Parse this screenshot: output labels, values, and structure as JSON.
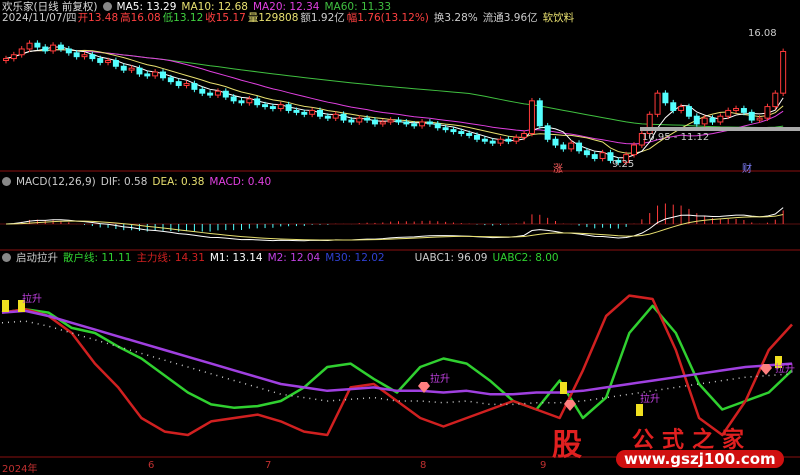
{
  "header": {
    "title": "欢乐家(日线 前复权)",
    "ma5": "MA5: 13.29",
    "ma10": "MA10: 12.68",
    "ma20": "MA20: 12.34",
    "ma60": "MA60: 11.33",
    "date": "2024/11/07/四",
    "open": "开13.48",
    "high": "高16.08",
    "low": "低13.12",
    "close": "收15.17",
    "volume": "量129808",
    "amount": "额1.92亿",
    "change": "幅1.76(13.12%)",
    "turnover": "换3.28%",
    "float": "流通3.96亿",
    "sector": "软饮料"
  },
  "macd_header": {
    "label": "MACD(12,26,9)",
    "dif": "DIF: 0.58",
    "dea": "DEA: 0.38",
    "macd": "MACD: 0.40"
  },
  "ind_header": {
    "label": "启动拉升",
    "retail": "散户线: 11.11",
    "main": "主力线: 14.31",
    "m1": "M1: 13.14",
    "m2": "M2: 12.04",
    "m30": "M30: 12.02",
    "uabc1": "UABC1: 96.09",
    "uabc2": "UABC2: 8.00"
  },
  "annotations": {
    "high": "16.08",
    "low": "9.25",
    "range": "10.95 - 11.12",
    "zhang": "涨",
    "cai": "财",
    "lasheng": "拉升"
  },
  "x_axis": [
    "2024年",
    "6",
    "7",
    "8",
    "9"
  ],
  "watermark": {
    "logo": "股",
    "title": "公式之家",
    "url": "www.gszj100.com"
  },
  "colors": {
    "up": "#ff3b3b",
    "down": "#54ffff",
    "ma5": "#ffffff",
    "ma10": "#e8e070",
    "ma20": "#e040e0",
    "ma60": "#40c040",
    "retail": "#30d030",
    "main": "#d02020",
    "m2": "#a040e0",
    "m30": "#3040d0"
  },
  "chart_data": [
    {
      "type": "candlestick",
      "name": "price",
      "close": [
        14.8,
        15.0,
        15.3,
        15.6,
        15.4,
        15.2,
        15.5,
        15.3,
        15.1,
        14.9,
        15.0,
        14.8,
        14.6,
        14.7,
        14.4,
        14.2,
        14.3,
        14.0,
        13.9,
        14.1,
        13.8,
        13.6,
        13.4,
        13.5,
        13.2,
        13.0,
        12.9,
        13.1,
        12.8,
        12.6,
        12.5,
        12.7,
        12.4,
        12.3,
        12.2,
        12.4,
        12.1,
        12.0,
        11.9,
        12.1,
        11.8,
        11.7,
        11.9,
        11.6,
        11.5,
        11.7,
        11.6,
        11.4,
        11.5,
        11.6,
        11.5,
        11.4,
        11.3,
        11.5,
        11.4,
        11.2,
        11.1,
        11.0,
        10.9,
        10.8,
        10.6,
        10.5,
        10.4,
        10.6,
        10.5,
        10.7,
        10.9,
        12.6,
        11.3,
        10.6,
        10.3,
        10.1,
        10.4,
        10.0,
        9.8,
        9.6,
        9.9,
        9.5,
        9.4,
        9.8,
        10.3,
        10.9,
        11.9,
        13.0,
        12.5,
        12.1,
        12.3,
        11.8,
        11.4,
        11.7,
        11.5,
        11.8,
        12.1,
        12.2,
        12.0,
        11.6,
        11.7,
        12.3,
        13.0,
        15.17
      ],
      "ylim": [
        9.0,
        16.6
      ]
    },
    {
      "type": "line",
      "name": "indicator",
      "retail": [
        82,
        84,
        82,
        73,
        70,
        62,
        55,
        45,
        35,
        28,
        26,
        27,
        30,
        38,
        50,
        52,
        43,
        35,
        50,
        55,
        52,
        42,
        30,
        25,
        42,
        20,
        32,
        70,
        86,
        70,
        40,
        25,
        30,
        35,
        48
      ],
      "main": [
        82,
        84,
        80,
        70,
        52,
        38,
        20,
        12,
        10,
        18,
        20,
        22,
        18,
        12,
        10,
        38,
        40,
        30,
        20,
        15,
        20,
        25,
        30,
        25,
        20,
        48,
        80,
        92,
        90,
        60,
        20,
        10,
        30,
        60,
        75
      ],
      "m2": [
        82,
        83,
        80,
        76,
        72,
        68,
        64,
        60,
        56,
        52,
        48,
        44,
        40,
        38,
        36,
        37,
        38,
        36,
        36,
        35,
        36,
        34,
        34,
        35,
        35,
        36,
        38,
        40,
        42,
        44,
        46,
        48,
        50,
        51,
        52
      ],
      "ylim": [
        0,
        100
      ]
    }
  ]
}
